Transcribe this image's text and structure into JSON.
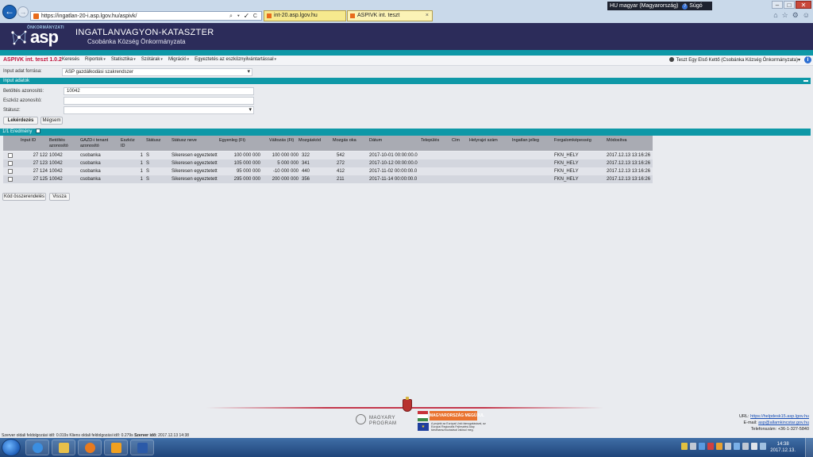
{
  "browser": {
    "url": "https://ingatlan-20-i.asp.lgov.hu/aspivk/",
    "tabs": [
      {
        "label": "int-20.asp.lgov.hu"
      },
      {
        "label": "ASPIVK int. teszt",
        "close": "×"
      }
    ],
    "lang": "HU magyar (Magyarország)",
    "help": "Súgó",
    "address_actions": "⌕ ▾ ✓ C"
  },
  "header": {
    "logo_small": "ÖNKORMÁNYZATI",
    "logo_big": "asp",
    "title": "INGATLANVAGYON-KATASZTER",
    "subtitle": "Csobánka Község Önkormányzata"
  },
  "menu": {
    "brand": "ASPIVK int. teszt 1.0.2",
    "items": [
      "Keresés",
      "Riportok",
      "Statisztika",
      "Szótárak",
      "Migráció",
      "Egyeztetés az eszköznyilvántartással"
    ],
    "caret": "▾",
    "user": "Teszt Egy Első Kettő (Csobánka Község Önkormányzata)",
    "info": "i"
  },
  "form": {
    "input_source_label": "Input adat forrása:",
    "input_source_value": "ASP gazdálkodási szakrendszer",
    "section_title": "Input adatok",
    "load_id_label": "Betöltés azonosító:",
    "load_id_value": "10042",
    "asset_id_label": "Eszköz azonosító:",
    "asset_id_value": "",
    "status_label": "Státusz:",
    "status_value": "",
    "query_button": "Lekérdezés",
    "cancel_button": "Mégsem",
    "chevron": "▾"
  },
  "results": {
    "bar_label": "1/1 Eredmény",
    "columns": [
      "Input ID",
      "Betöltés azonosító",
      "GAZD-i tenant azonosító",
      "Eszköz ID",
      "Státusz",
      "Státusz neve",
      "Egyenleg (Ft)",
      "Változás (Ft)",
      "Mozgáskód",
      "Mozgás oka",
      "Dátum",
      "Település",
      "Cím",
      "Helyrajzi szám",
      "Ingatlan jelleg",
      "Forgalomképesség",
      "Módosítva"
    ],
    "rows": [
      {
        "input_id": "27 122",
        "load_id": "10042",
        "tenant": "csobanka",
        "asset_id": "1",
        "status": "S",
        "status_name": "Sikeresen egyeztetett",
        "balance": "100 000 000",
        "change": "100 000 000",
        "move_code": "322",
        "move_reason": "542",
        "date": "2017-10-01 00:00:00.0",
        "marketability": "FKN_HELY",
        "modified": "2017.12.13 13:16:26"
      },
      {
        "input_id": "27 123",
        "load_id": "10042",
        "tenant": "csobanka",
        "asset_id": "1",
        "status": "S",
        "status_name": "Sikeresen egyeztetett",
        "balance": "105 000 000",
        "change": "5 000 000",
        "move_code": "341",
        "move_reason": "272",
        "date": "2017-10-12 00:00:00.0",
        "marketability": "FKN_HELY",
        "modified": "2017.12.13 13:16:26"
      },
      {
        "input_id": "27 124",
        "load_id": "10042",
        "tenant": "csobanka",
        "asset_id": "1",
        "status": "S",
        "status_name": "Sikeresen egyeztetett",
        "balance": "95 000 000",
        "change": "-10 000 000",
        "move_code": "440",
        "move_reason": "412",
        "date": "2017-11-02 00:00:00.0",
        "marketability": "FKN_HELY",
        "modified": "2017.12.13 13:16:26"
      },
      {
        "input_id": "27 125",
        "load_id": "10042",
        "tenant": "csobanka",
        "asset_id": "1",
        "status": "S",
        "status_name": "Sikeresen egyeztetett",
        "balance": "295 000 000",
        "change": "200 000 000",
        "move_code": "356",
        "move_reason": "211",
        "date": "2017-11-14 00:00:00.0",
        "marketability": "FKN_HELY",
        "modified": "2017.12.13 13:16:26"
      }
    ],
    "code_button": "Kód összerendelés",
    "back_button": "Vissza"
  },
  "footer": {
    "magyary_1": "MAGYARY",
    "magyary_2": "PROGRAM",
    "hat_banner": "MAGYARORSZÁG MEGÚJUL",
    "eu_stars": "★",
    "eu_text": "A projekt az Európai Unió támogatásával, az Európai Regionális Fejlesztési Alap társfinanszírozásával valósul meg.",
    "url_label": "URL:",
    "url_value": "https://helpdesk15.asp.lgov.hu",
    "email_label": "E-mail:",
    "email_value": "asp@allamkincstar.gov.hu",
    "phone_label": "Telefonszám:",
    "phone_value": "+36-1-327-5840",
    "status_text": "Szerver oldali feldolgozási idő: 0.019s Kliens oldali feldolgozási idő: 0.279s",
    "server_time_label": "Szerver idő:",
    "server_time_value": "2017.12.13 14:38"
  },
  "taskbar": {
    "time": "14:38",
    "date": "2017.12.13."
  },
  "colors": {
    "header": "#2c2c5a",
    "teal": "#0e98a7",
    "brand_red": "#c0143c"
  }
}
